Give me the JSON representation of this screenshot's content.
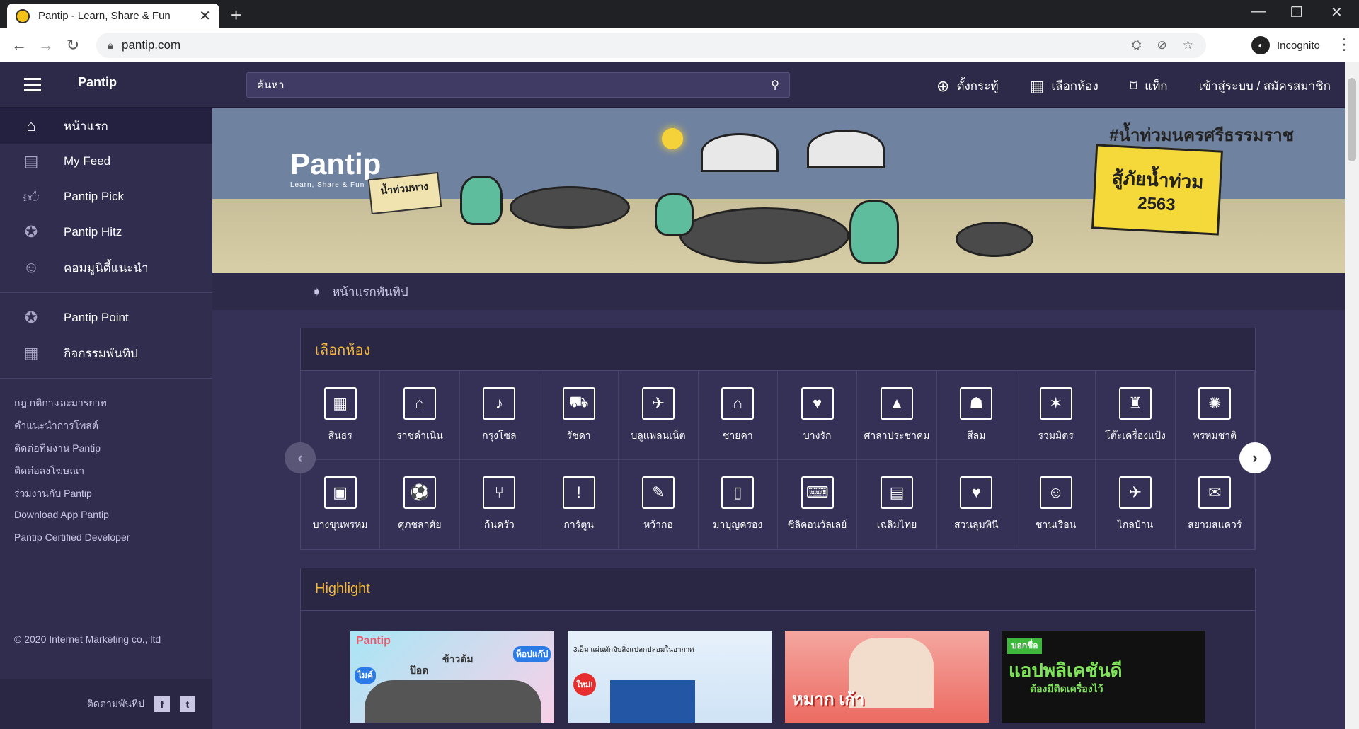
{
  "browser": {
    "tab_title": "Pantip - Learn, Share & Fun",
    "url": "pantip.com",
    "profile": "Incognito"
  },
  "header": {
    "logo": "Pantip",
    "search_placeholder": "ค้นหา",
    "links": {
      "post": "ตั้งกระทู้",
      "rooms": "เลือกห้อง",
      "tags": "แท็ก",
      "login": "เข้าสู่ระบบ / สมัครสมาชิก"
    }
  },
  "sidebar": {
    "items": [
      {
        "label": "หน้าแรก",
        "icon": "home-icon"
      },
      {
        "label": "My Feed",
        "icon": "feed-icon"
      },
      {
        "label": "Pantip Pick",
        "icon": "thumbs-up-icon"
      },
      {
        "label": "Pantip Hitz",
        "icon": "star-badge-icon"
      },
      {
        "label": "คอมมูนิตี้แนะนำ",
        "icon": "smile-icon"
      }
    ],
    "items2": [
      {
        "label": "Pantip Point",
        "icon": "star-circle-icon"
      },
      {
        "label": "กิจกรรมพันทิป",
        "icon": "calendar-icon"
      }
    ],
    "links": [
      "กฎ กติกาและมารยาท",
      "คำแนะนำการโพสต์",
      "ติดต่อทีมงาน Pantip",
      "ติดต่อลงโฆษณา",
      "ร่วมงานกับ Pantip",
      "Download App Pantip",
      "Pantip Certified Developer"
    ],
    "copyright": "© 2020 Internet Marketing co., ltd",
    "follow_label": "ติดตามพันทิป"
  },
  "banner": {
    "logo": "Pantip",
    "tagline": "Learn, Share & Fun",
    "hashtag": "#น้ำท่วมนครศรีธรรมราช",
    "sign_line1": "สู้ภัยน้ำท่วม",
    "sign_line2": "2563",
    "small_sign": "น้ำท่วมทาง"
  },
  "breadcrumb": "หน้าแรกพันทิป",
  "rooms_panel": {
    "title": "เลือกห้อง",
    "rooms": [
      {
        "label": "สินธร",
        "icon": "▦"
      },
      {
        "label": "ราชดำเนิน",
        "icon": "⌂"
      },
      {
        "label": "กรุงโซล",
        "icon": "♪"
      },
      {
        "label": "รัชดา",
        "icon": "⛟"
      },
      {
        "label": "บลูแพลนเน็ต",
        "icon": "✈"
      },
      {
        "label": "ชายคา",
        "icon": "⌂"
      },
      {
        "label": "บางรัก",
        "icon": "♥"
      },
      {
        "label": "ศาลาประชาคม",
        "icon": "▲"
      },
      {
        "label": "สีลม",
        "icon": "☗"
      },
      {
        "label": "รวมมิตร",
        "icon": "✶"
      },
      {
        "label": "โต๊ะเครื่องแป้ง",
        "icon": "♜"
      },
      {
        "label": "พรหมชาติ",
        "icon": "✺"
      },
      {
        "label": "บางขุนพรหม",
        "icon": "▣"
      },
      {
        "label": "ศุภชลาศัย",
        "icon": "⚽"
      },
      {
        "label": "ก้นครัว",
        "icon": "⑂"
      },
      {
        "label": "การ์ตูน",
        "icon": "!"
      },
      {
        "label": "หว้ากอ",
        "icon": "✎"
      },
      {
        "label": "มาบุญครอง",
        "icon": "▯"
      },
      {
        "label": "ซิลิคอนวัลเลย์",
        "icon": "⌨"
      },
      {
        "label": "เฉลิมไทย",
        "icon": "▤"
      },
      {
        "label": "สวนลุมพินี",
        "icon": "♥"
      },
      {
        "label": "ชานเรือน",
        "icon": "☺"
      },
      {
        "label": "ไกลบ้าน",
        "icon": "✈"
      },
      {
        "label": "สยามสแควร์",
        "icon": "✉"
      }
    ]
  },
  "highlight_panel": {
    "title": "Highlight",
    "cards": [
      {
        "caption": "Pantip",
        "tag1": "ข้าวต้ม",
        "tag2": "ท็อปแก๊ป",
        "tag3": "ไมค์",
        "tag4": "ป๊อด"
      },
      {
        "caption": "3เอ็ม แผ่นดักจับสิ่งแปลกปลอมในอากาศ",
        "tag1": "ใหม่!"
      },
      {
        "caption": "หมาก เก้า"
      },
      {
        "caption": "แอปพลิเคชันดี",
        "tag1": "บอกชื่อ",
        "tag2": "ต้องมีติดเครื่องไว้"
      }
    ]
  }
}
